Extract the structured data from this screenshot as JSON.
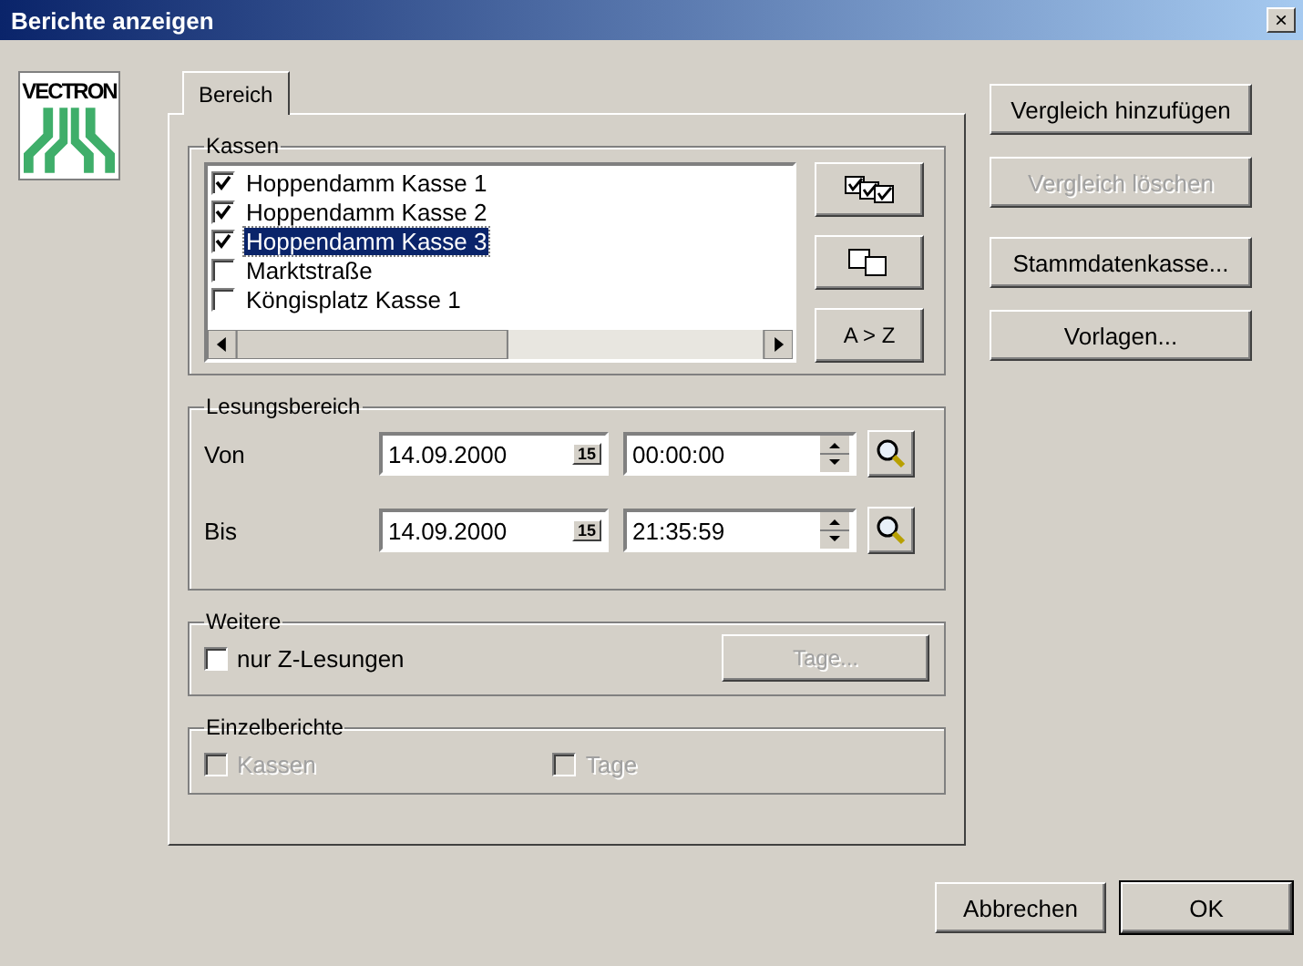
{
  "window": {
    "title": "Berichte anzeigen",
    "close": "×"
  },
  "logo": {
    "text": "VECTRON"
  },
  "tabs": [
    {
      "label": "Bereich",
      "selected": true
    }
  ],
  "kassen": {
    "legend": "Kassen",
    "items": [
      {
        "label": "Hoppendamm Kasse 1",
        "checked": true,
        "selected": false
      },
      {
        "label": "Hoppendamm Kasse 2",
        "checked": true,
        "selected": false
      },
      {
        "label": "Hoppendamm Kasse 3",
        "checked": true,
        "selected": true
      },
      {
        "label": "Marktstraße",
        "checked": false,
        "selected": false
      },
      {
        "label": "Köngisplatz Kasse 1",
        "checked": false,
        "selected": false
      }
    ],
    "buttons": [
      {
        "kind": "check-all"
      },
      {
        "kind": "uncheck-all"
      },
      {
        "kind": "sort",
        "label": "A > Z"
      }
    ]
  },
  "lesungsbereich": {
    "legend": "Lesungsbereich",
    "rows": [
      {
        "label": "Von",
        "date": "14.09.2000",
        "calendar": "15",
        "time": "00:00:00"
      },
      {
        "label": "Bis",
        "date": "14.09.2000",
        "calendar": "15",
        "time": "21:35:59"
      }
    ]
  },
  "weitere": {
    "legend": "Weitere",
    "option": {
      "label": "nur Z-Lesungen",
      "checked": false
    },
    "button": {
      "label": "Tage...",
      "disabled": true
    }
  },
  "einzelberichte": {
    "legend": "Einzelberichte",
    "disabled": true,
    "options": [
      {
        "label": "Kassen",
        "checked": false
      },
      {
        "label": "Tage",
        "checked": false
      }
    ]
  },
  "side_buttons": [
    {
      "label": "Vergleich hinzufügen",
      "disabled": false
    },
    {
      "label": "Vergleich löschen",
      "disabled": true
    },
    {
      "label": "Stammdatenkasse...",
      "disabled": false
    },
    {
      "label": "Vorlagen...",
      "disabled": false
    }
  ],
  "dialog_buttons": [
    {
      "label": "Abbrechen",
      "default": false
    },
    {
      "label": "OK",
      "default": true
    }
  ]
}
